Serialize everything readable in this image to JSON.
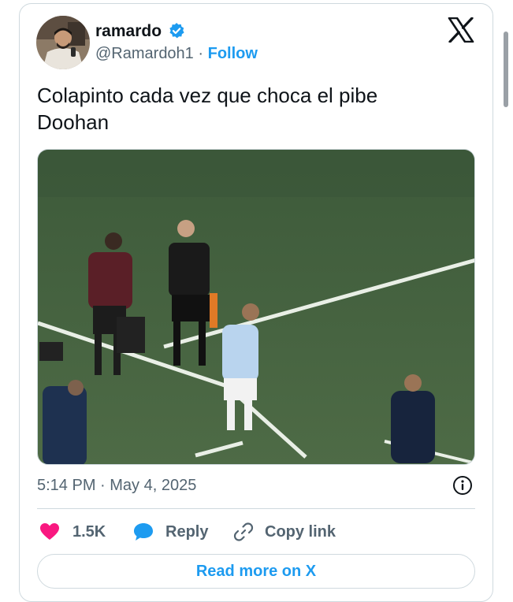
{
  "author": {
    "name": "ramardo",
    "handle": "@Ramardoh1",
    "separator": "·",
    "follow_label": "Follow",
    "verified": true
  },
  "tweet": {
    "text_line1": "Colapinto cada vez que choca el pibe",
    "text_line2": "Doohan",
    "timestamp": "5:14 PM · May 4, 2025"
  },
  "actions": {
    "like_count": "1.5K",
    "reply_label": "Reply",
    "copy_link_label": "Copy link"
  },
  "read_more_label": "Read more on X",
  "icons": {
    "verified": "verified-badge-icon",
    "brand": "x-logo-icon",
    "info": "info-icon",
    "like": "heart-icon",
    "reply": "speech-bubble-icon",
    "copy": "link-icon"
  },
  "colors": {
    "accent": "#1d9bf0",
    "like": "#f91880",
    "muted_text": "#536471",
    "border": "#cfd9de"
  }
}
